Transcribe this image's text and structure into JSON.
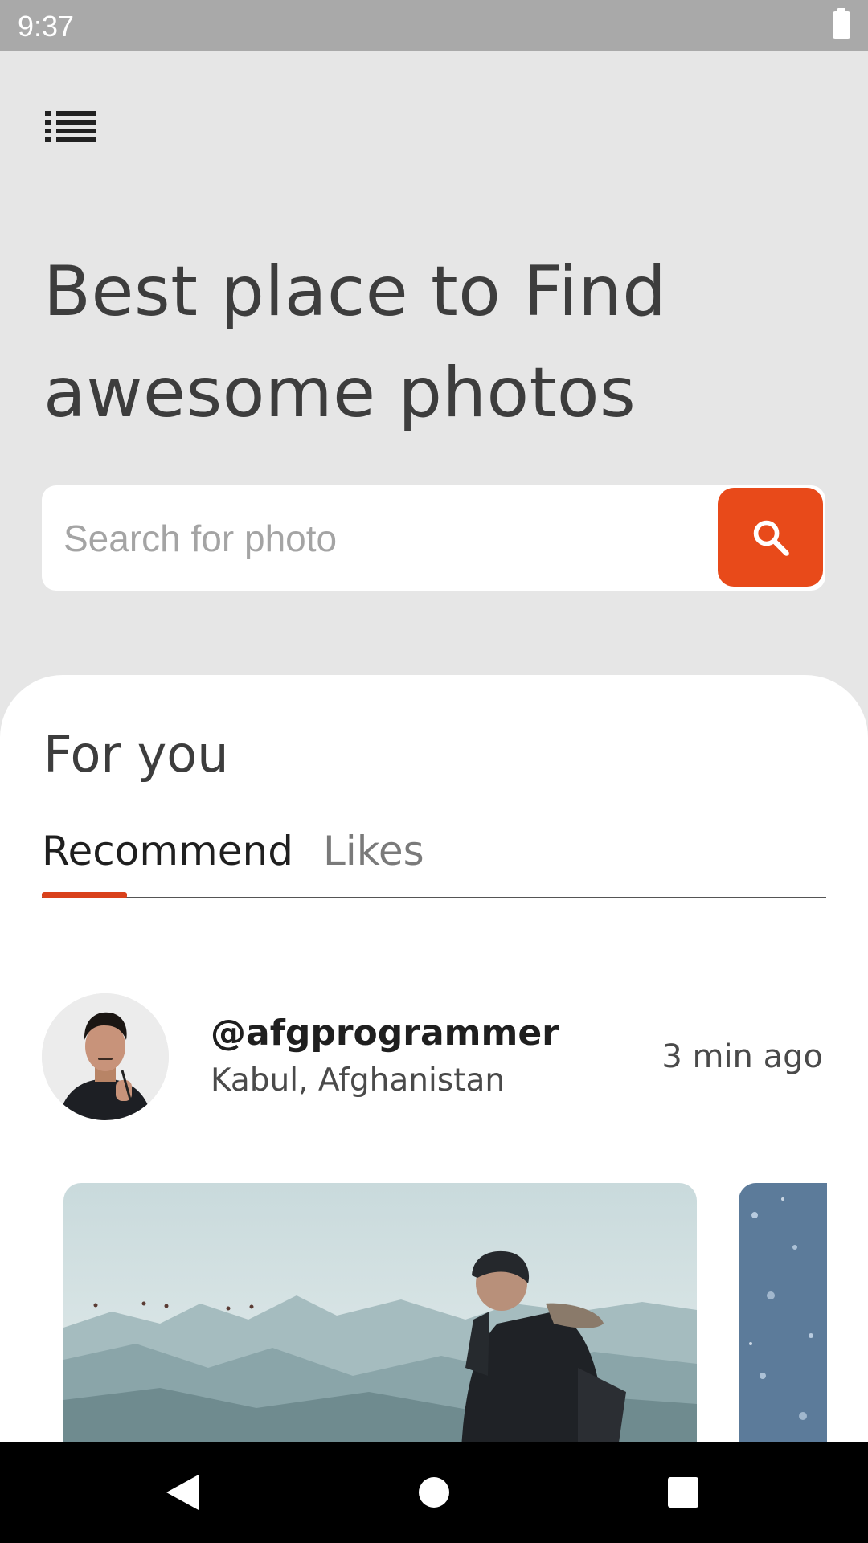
{
  "status_bar": {
    "time": "9:37"
  },
  "header": {
    "headline_line1": "Best place to Find",
    "headline_line2": "awesome photos"
  },
  "search": {
    "placeholder": "Search for photo"
  },
  "feed": {
    "title": "For you",
    "tabs": [
      {
        "label": "Recommend",
        "selected": true
      },
      {
        "label": "Likes",
        "selected": false
      }
    ]
  },
  "post": {
    "username": "@afgprogrammer",
    "location": "Kabul, Afghanistan",
    "time": "3 min ago"
  },
  "colors": {
    "accent": "#e84a1a",
    "background": "#e6e6e6",
    "card": "#ffffff",
    "text_primary": "#3d3d3d"
  },
  "icons": {
    "menu": "list-menu-icon",
    "search": "search-icon",
    "back": "back-triangle-icon",
    "home": "home-circle-icon",
    "recents": "recents-square-icon"
  }
}
